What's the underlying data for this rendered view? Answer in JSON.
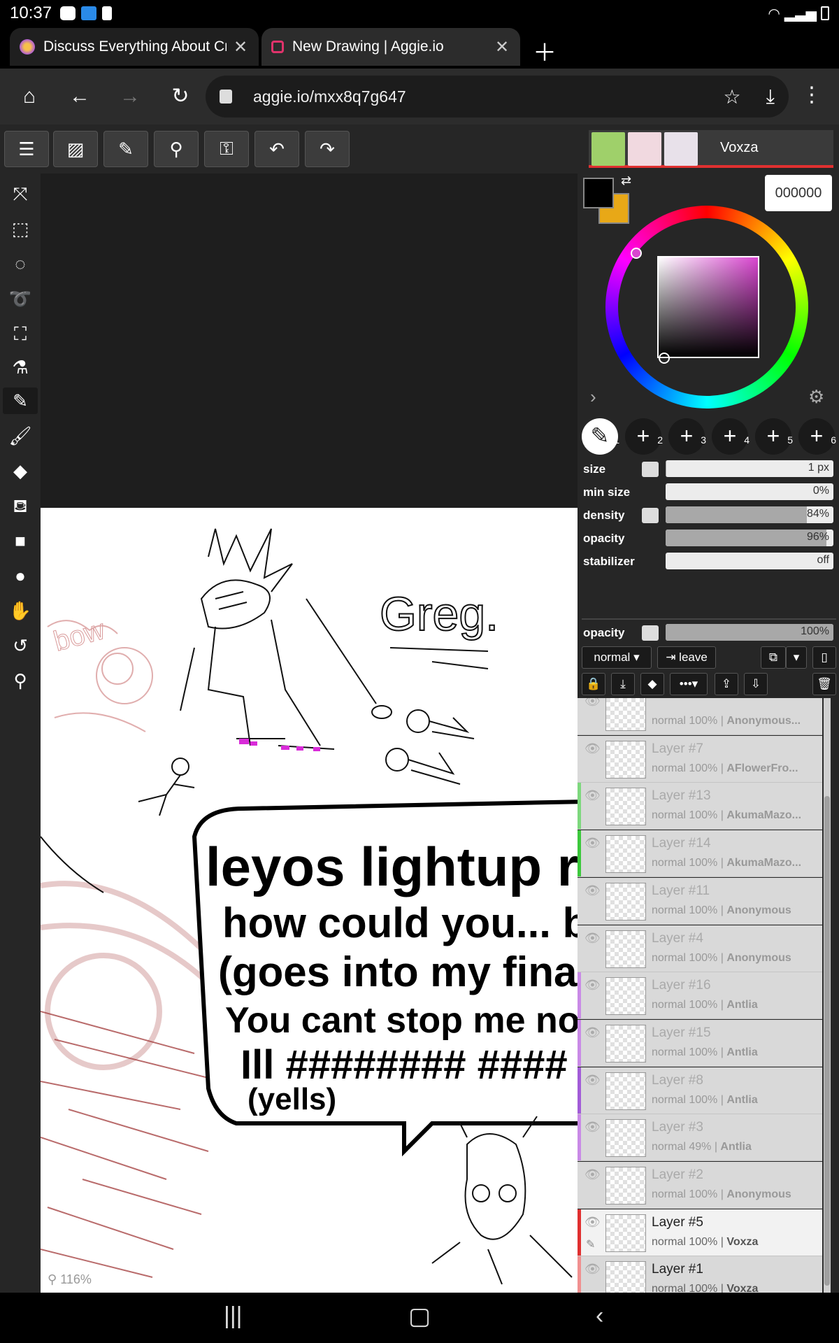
{
  "status": {
    "time": "10:37"
  },
  "tabs": [
    {
      "title": "Discuss Everything About Cr",
      "favicon_color": "#b05cd8"
    },
    {
      "title": "New Drawing | Aggie.io",
      "favicon_color": "#e0336b"
    }
  ],
  "browser": {
    "url": "aggie.io/mxx8q7g647"
  },
  "users": {
    "current": "Voxza"
  },
  "color": {
    "hex": "000000",
    "primary": "#000000",
    "secondary": "#e8a817"
  },
  "brush_slots": [
    "1",
    "2",
    "3",
    "4",
    "5",
    "6"
  ],
  "brush": {
    "size": {
      "label": "size",
      "value": "1 px",
      "level": 0.003
    },
    "min_size": {
      "label": "min size",
      "value": "0%",
      "level": 0
    },
    "density": {
      "label": "density",
      "value": "84%",
      "level": 0.84
    },
    "opacity": {
      "label": "opacity",
      "value": "96%",
      "level": 0.96
    },
    "stabilizer": {
      "label": "stabilizer",
      "value": "off",
      "level": 0
    }
  },
  "layer_opacity": {
    "label": "opacity",
    "value": "100%",
    "level": 1.0
  },
  "layer_controls": {
    "blend_mode": "normal",
    "leave_label": "leave"
  },
  "layers": [
    {
      "name": "",
      "mode": "normal 100%",
      "owner": "Anonymous...",
      "mark": ""
    },
    {
      "name": "Layer #7",
      "mode": "normal 100%",
      "owner": "AFlowerFro...",
      "mark": ""
    },
    {
      "name": "Layer #13",
      "mode": "normal 100%",
      "owner": "AkumaMazo...",
      "mark": "#7ed87e"
    },
    {
      "name": "Layer #14",
      "mode": "normal 100%",
      "owner": "AkumaMazo...",
      "mark": "#3cc83c"
    },
    {
      "name": "Layer #11",
      "mode": "normal 100%",
      "owner": "Anonymous",
      "mark": ""
    },
    {
      "name": "Layer #4",
      "mode": "normal 100%",
      "owner": "Anonymous",
      "mark": ""
    },
    {
      "name": "Layer #16",
      "mode": "normal 100%",
      "owner": "Antlia",
      "mark": "#c98ae6"
    },
    {
      "name": "Layer #15",
      "mode": "normal 100%",
      "owner": "Antlia",
      "mark": "#c98ae6"
    },
    {
      "name": "Layer #8",
      "mode": "normal 100%",
      "owner": "Antlia",
      "mark": "#a25cd8"
    },
    {
      "name": "Layer #3",
      "mode": "normal 49%",
      "owner": "Antlia",
      "mark": "#c98ae6"
    },
    {
      "name": "Layer #2",
      "mode": "normal 100%",
      "owner": "Anonymous",
      "mark": ""
    },
    {
      "name": "Layer #5",
      "mode": "normal 100%",
      "owner": "Voxza",
      "mark": "#e03030"
    },
    {
      "name": "Layer #1",
      "mode": "normal 100%",
      "owner": "Voxza",
      "mark": "#f09090"
    }
  ],
  "canvas": {
    "zoom": "116%",
    "text_greg": "Greg.",
    "text_bow": "bow",
    "speech_lines": [
      "leyos lightup rea",
      "how could you... betr",
      "(goes into my final form",
      "You cant stop me now!",
      "Ill ######## ####",
      "(yells)"
    ]
  }
}
